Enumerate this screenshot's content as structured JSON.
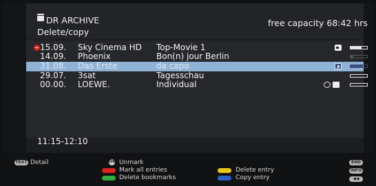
{
  "header": {
    "title": "DR ARCHIVE",
    "subtitle": "Delete/copy",
    "capacity": "free capacity 68:42 hrs"
  },
  "recordings": [
    {
      "date": "15.09.",
      "channel": "Sky Cinema HD",
      "title": "Top-Movie 1",
      "progress": 0.65,
      "icons": [
        "alert-icon",
        "lock-icon"
      ],
      "selected": false
    },
    {
      "date": "14.09.",
      "channel": "Phoenix",
      "title": "Bon(n) jour Berlin",
      "progress": 0.15,
      "icons": [],
      "selected": false
    },
    {
      "date": "31.08.",
      "channel": "Das Erste",
      "title": "da capo",
      "progress": 0.75,
      "icons": [
        "play-icon"
      ],
      "selected": true
    },
    {
      "date": "29.07.",
      "channel": "3sat",
      "title": "Tagesschau",
      "progress": 0.0,
      "icons": [],
      "selected": false
    },
    {
      "date": "00.00.",
      "channel": "LOEWE.",
      "title": "Individual",
      "progress": 0.0,
      "icons": [
        "disc-icon",
        "folder-icon"
      ],
      "selected": false
    }
  ],
  "time_range": "11:15-12:10",
  "legend": {
    "text_key": "TEXT",
    "detail": "Detail",
    "ok_key": "OK",
    "unmark": "Unmark",
    "mark_all": "Mark all entries",
    "delete_bookmarks": "Delete bookmarks",
    "delete_entry": "Delete entry",
    "copy_entry": "Copy entry",
    "end_key": "END",
    "info_key": "INFO"
  },
  "colors": {
    "selection": "#8fb3d6",
    "red": "#d9231f",
    "green": "#35a93c",
    "yellow": "#e8c617",
    "blue": "#2a61c4"
  }
}
